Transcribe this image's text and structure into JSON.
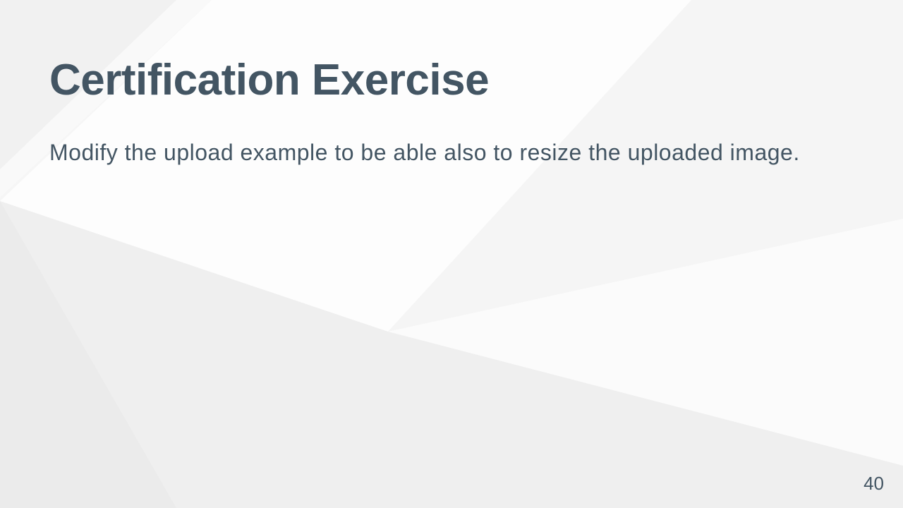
{
  "slide": {
    "title": "Certification Exercise",
    "body": "Modify the upload example to be able also to resize the uploaded image.",
    "page_number": "40"
  },
  "colors": {
    "text": "#435563",
    "background_light": "#ffffff",
    "background_shade": "#ececec"
  }
}
